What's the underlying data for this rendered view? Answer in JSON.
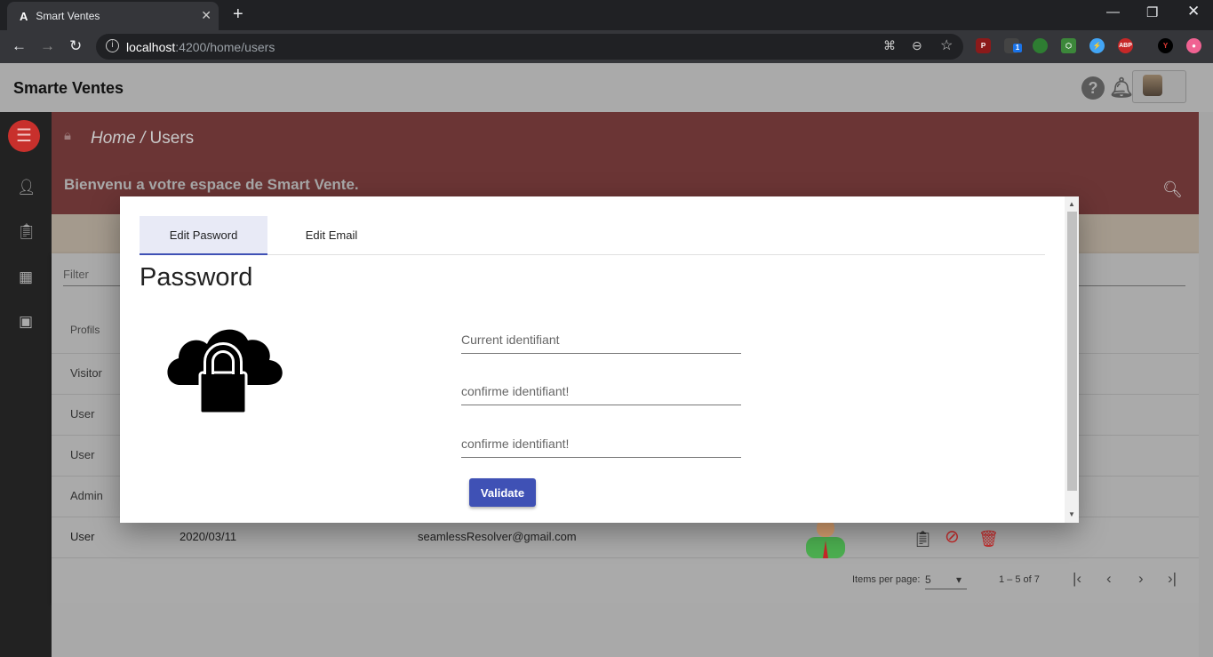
{
  "browser": {
    "tab_title": "Smart Ventes",
    "url_host": "localhost",
    "url_path": ":4200/home/users",
    "new_tab_symbol": "+",
    "ext_badge": "1",
    "ext_abp": "ABP"
  },
  "header": {
    "brand": "Smarte Ventes",
    "help_icon": "?",
    "bell_icon": "bell-icon"
  },
  "breadcrumb": {
    "home": "Home",
    "sep": " / ",
    "current": "Users"
  },
  "banner": {
    "welcome": "Bienvenu a votre espace de Smart Vente."
  },
  "table": {
    "filter_placeholder": "Filter",
    "col_profils": "Profils",
    "rows": [
      {
        "profil": "Visitor"
      },
      {
        "profil": "User"
      },
      {
        "profil": "User"
      },
      {
        "profil": "Admin"
      }
    ],
    "last_row": {
      "profil": "User",
      "date": "2020/03/11",
      "email": "seamlessResolver@gmail.com"
    }
  },
  "paginator": {
    "items_label": "Items per page:",
    "page_size": "5",
    "range": "1 – 5 of 7"
  },
  "dialog": {
    "tabs": [
      "Edit Pasword",
      "Edit Email"
    ],
    "title": "Password",
    "fields": [
      "Current identifiant",
      "confirme identifiant!",
      "confirme identifiant!"
    ],
    "validate": "Validate"
  },
  "colors": {
    "accent": "#3f51b5",
    "banner": "#6b3535",
    "menu": "#c8302c"
  }
}
